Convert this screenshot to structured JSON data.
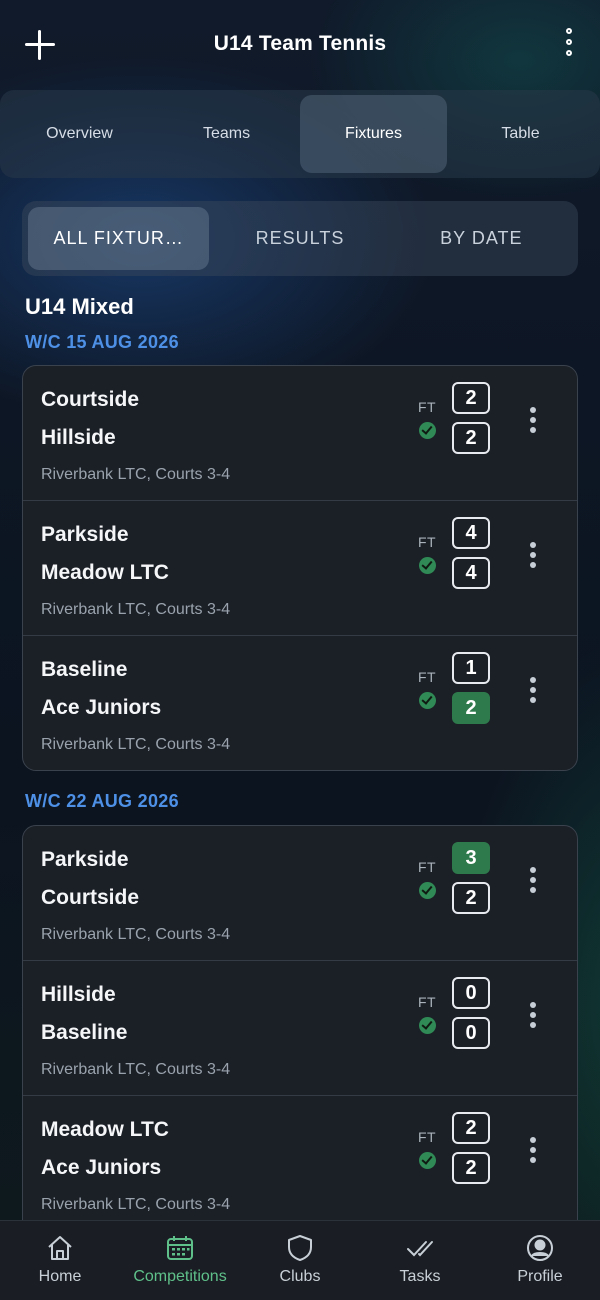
{
  "header": {
    "title": "U14 Team Tennis",
    "add_icon": "plus-icon",
    "menu_icon": "more-vertical-icon"
  },
  "tabs": [
    {
      "label": "Overview",
      "active": false
    },
    {
      "label": "Teams",
      "active": false
    },
    {
      "label": "Fixtures",
      "active": true
    },
    {
      "label": "Table",
      "active": false
    }
  ],
  "segments": [
    {
      "label": "ALL FIXTUR…",
      "active": true
    },
    {
      "label": "RESULTS",
      "active": false
    },
    {
      "label": "BY DATE",
      "active": false
    }
  ],
  "section": {
    "title": "U14 Mixed"
  },
  "weeks": [
    {
      "label": "W/C 15 AUG 2026",
      "matches": [
        {
          "home": "Courtside",
          "away": "Hillside",
          "home_score": "2",
          "away_score": "2",
          "status": "FT",
          "venue": "Riverbank LTC, Courts 3-4",
          "winner": null
        },
        {
          "home": "Parkside",
          "away": "Meadow LTC",
          "home_score": "4",
          "away_score": "4",
          "status": "FT",
          "venue": "Riverbank LTC, Courts 3-4",
          "winner": null
        },
        {
          "home": "Baseline",
          "away": "Ace Juniors",
          "home_score": "1",
          "away_score": "2",
          "status": "FT",
          "venue": "Riverbank LTC, Courts 3-4",
          "winner": "away"
        }
      ]
    },
    {
      "label": "W/C 22 AUG 2026",
      "matches": [
        {
          "home": "Parkside",
          "away": "Courtside",
          "home_score": "3",
          "away_score": "2",
          "status": "FT",
          "venue": "Riverbank LTC, Courts 3-4",
          "winner": "home"
        },
        {
          "home": "Hillside",
          "away": "Baseline",
          "home_score": "0",
          "away_score": "0",
          "status": "FT",
          "venue": "Riverbank LTC, Courts 3-4",
          "winner": null
        },
        {
          "home": "Meadow LTC",
          "away": "Ace Juniors",
          "home_score": "2",
          "away_score": "2",
          "status": "FT",
          "venue": "Riverbank LTC, Courts 3-4",
          "winner": null
        }
      ]
    }
  ],
  "bottom_nav": [
    {
      "label": "Home",
      "icon": "home-icon",
      "active": false
    },
    {
      "label": "Competitions",
      "icon": "calendar-icon",
      "active": true
    },
    {
      "label": "Clubs",
      "icon": "shield-icon",
      "active": false
    },
    {
      "label": "Tasks",
      "icon": "double-check-icon",
      "active": false
    },
    {
      "label": "Profile",
      "icon": "profile-icon",
      "active": false
    }
  ],
  "colors": {
    "accent_blue": "#4d90e6",
    "win_green": "#2f7a4c",
    "nav_active": "#5fc08a",
    "card_bg": "#1b1f26"
  }
}
